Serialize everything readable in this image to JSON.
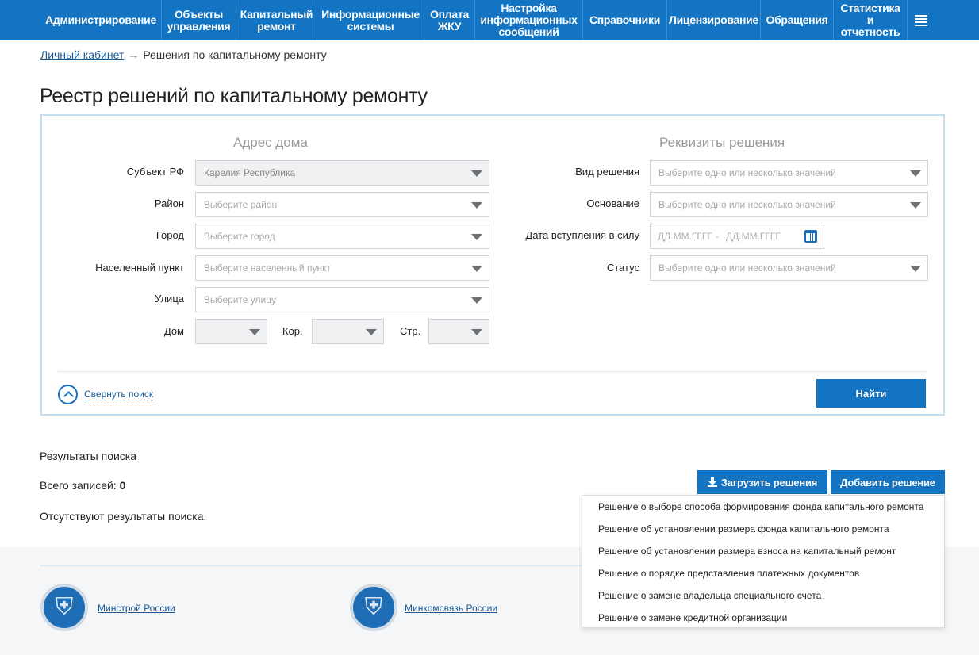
{
  "nav": {
    "items": [
      "Администрирование",
      "Объекты\nуправления",
      "Капитальный\nремонт",
      "Информационные\nсистемы",
      "Оплата\nЖКУ",
      "Настройка\nинформационных\nсообщений",
      "Справочники",
      "Лицензирование",
      "Обращения",
      "Статистика\nи\nотчетность"
    ],
    "menu_icon": "hamburger-icon",
    "bg_color": "#1274c2"
  },
  "breadcrumb": {
    "home": "Личный кабинет",
    "arrow": "→",
    "current": "Решения по капитальному ремонту"
  },
  "page_title": "Реестр решений по капитальному ремонту",
  "search": {
    "address_title": "Адрес дома",
    "requisites_title": "Реквизиты решения",
    "subject_label": "Субъект РФ",
    "subject_value": "Карелия Республика",
    "district_label": "Район",
    "district_placeholder": "Выберите район",
    "city_label": "Город",
    "city_placeholder": "Выберите город",
    "settlement_label": "Населенный пункт",
    "settlement_placeholder": "Выберите населенный пункт",
    "street_label": "Улица",
    "street_placeholder": "Выберите улицу",
    "house_label": "Дом",
    "building_label": "Кор.",
    "structure_label": "Стр.",
    "decision_type_label": "Вид решения",
    "decision_type_placeholder": "Выберите одно или несколько значений",
    "basis_label": "Основание",
    "basis_placeholder": "Выберите одно или несколько значений",
    "date_label": "Дата вступления в силу",
    "date_from_placeholder": "ДД.ММ.ГГГГ",
    "date_sep": "-",
    "date_to_placeholder": "ДД.ММ.ГГГГ",
    "status_label": "Статус",
    "status_placeholder": "Выберите одно или несколько значений",
    "collapse_label": "Свернуть поиск",
    "find_button": "Найти"
  },
  "results": {
    "title": "Результаты поиска",
    "total_label": "Всего записей:",
    "total_value": "0",
    "empty_text": "Отсутствуют результаты поиска.",
    "upload_button": "Загрузить решения",
    "add_button": "Добавить решение"
  },
  "add_menu": [
    "Решение о выборе способа формирования фонда капитального ремонта",
    "Решение об установлении размера фонда капитального ремонта",
    "Решение об установлении размера взноса на капитальный ремонт",
    "Решение о порядке представления платежных документов",
    "Решение о замене владельца специального счета",
    "Решение о замене кредитной организации"
  ],
  "footer": {
    "link1": "Минстрой России",
    "link2": "Минкомсвязь России"
  }
}
